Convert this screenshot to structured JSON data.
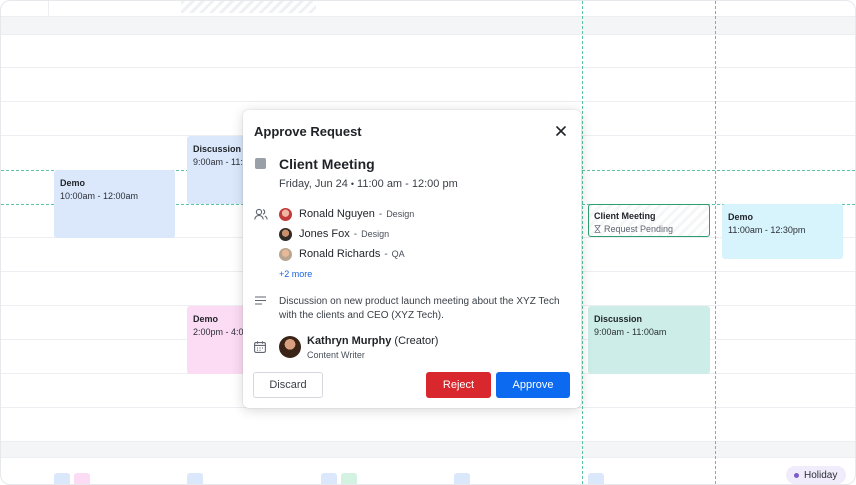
{
  "calendar": {
    "events": [
      {
        "id": "discussion-1",
        "title": "Discussion",
        "time": "9:00am - 11:"
      },
      {
        "id": "demo-1",
        "title": "Demo",
        "time": "10:00am - 12:00am"
      },
      {
        "id": "demo-2",
        "title": "Demo",
        "time": "2:00pm - 4:0"
      },
      {
        "id": "client-meeting",
        "title": "Client Meeting",
        "status": "Request Pending"
      },
      {
        "id": "demo-3",
        "title": "Demo",
        "time": "11:00am - 12:30pm"
      },
      {
        "id": "discussion-2",
        "title": "Discussion",
        "time": "9:00am - 11:00am"
      }
    ],
    "holiday_badge": "Holiday"
  },
  "modal": {
    "title": "Approve Request",
    "event": {
      "name": "Client Meeting",
      "day": "Friday, Jun 24",
      "time": "11:00 am - 12:00 pm"
    },
    "attendees": [
      {
        "name": "Ronald Nguyen",
        "role": "Design"
      },
      {
        "name": "Jones Fox",
        "role": "Design"
      },
      {
        "name": "Ronald Richards",
        "role": "QA"
      }
    ],
    "more_label": "+2 more",
    "description": "Discussion on new product launch meeting about the XYZ Tech with the clients and CEO (XYZ Tech).",
    "creator": {
      "name": "Kathryn Murphy",
      "suffix": "(Creator)",
      "role": "Content Writer"
    },
    "buttons": {
      "discard": "Discard",
      "reject": "Reject",
      "approve": "Approve"
    }
  },
  "colors": {
    "reject": "#d9272e",
    "approve": "#0b6af0",
    "pending_border": "#2f9e6e",
    "link": "#1a66e0"
  },
  "icons": [
    "close-icon",
    "attendees-icon",
    "description-icon",
    "calendar-icon",
    "hourglass-icon"
  ]
}
